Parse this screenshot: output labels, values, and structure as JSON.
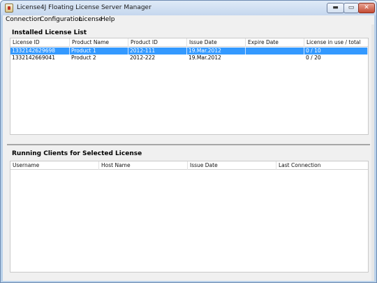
{
  "window": {
    "title": "License4J Floating License Server Manager"
  },
  "window_controls": {
    "minimize": "▬",
    "maximize": "▭",
    "close": "✕"
  },
  "menu": [
    "Connection",
    "Configuration",
    "License",
    "Help"
  ],
  "installed": {
    "title": "Installed License List",
    "columns": [
      "License ID",
      "Product Name",
      "Product ID",
      "Issue Date",
      "Expire Date",
      "License in use / total"
    ],
    "rows": [
      {
        "license_id": "1332142629698",
        "product_name": "Product 1",
        "product_id": "2012-111",
        "issue_date": "19.Mar.2012",
        "expire_date": "",
        "in_use": "0 / 10",
        "selected": true
      },
      {
        "license_id": "1332142669041",
        "product_name": "Product 2",
        "product_id": "2012-222",
        "issue_date": "19.Mar.2012",
        "expire_date": "",
        "in_use": "0 / 20",
        "selected": false
      }
    ]
  },
  "clients": {
    "title": "Running Clients for Selected License",
    "columns": [
      "Username",
      "Host Name",
      "Issue Date",
      "Last Connection"
    ]
  },
  "colors": {
    "selection": "#3399ff",
    "titlebar": "#c5d7ee",
    "panel": "#f0f0f0"
  }
}
